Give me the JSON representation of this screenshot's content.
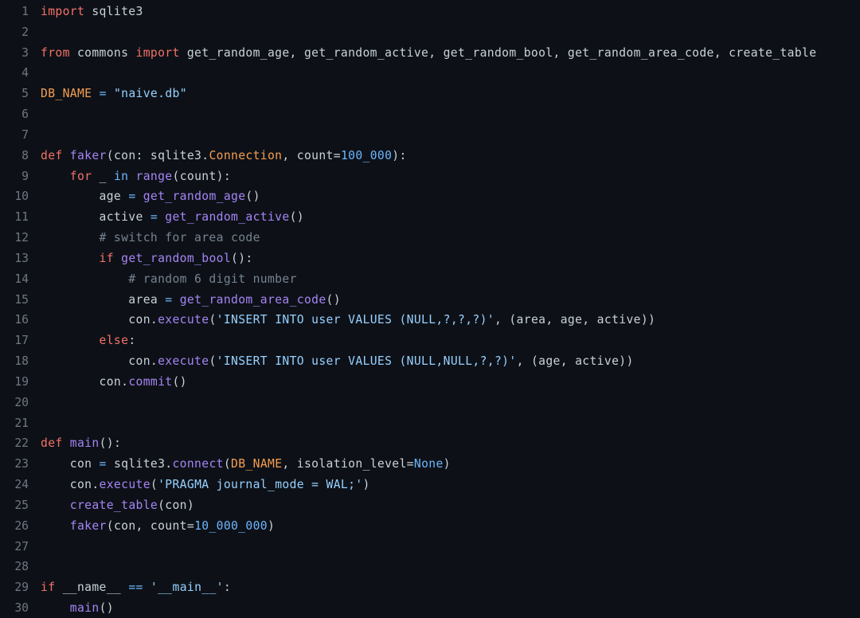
{
  "editor": {
    "language": "python",
    "theme": "github-dark-dimmed",
    "background_color": "#0d1117",
    "gutter_color": "#6e7681",
    "default_text_color": "#c9d1d9",
    "first_visible_line": 1,
    "last_visible_line": 30,
    "total_visible_lines": 30,
    "colors": {
      "keyword": "#f47067",
      "function": "#a684f5",
      "string": "#96d0ff",
      "number": "#6cb6ff",
      "constant": "#f69d50",
      "operator": "#6cb6ff",
      "comment": "#768390",
      "plain": "#c9d1d9"
    }
  },
  "lines": [
    {
      "number": "1",
      "tokens": [
        {
          "t": "import",
          "c": "t-kw"
        },
        {
          "t": " sqlite3",
          "c": "t-pln"
        }
      ]
    },
    {
      "number": "2",
      "tokens": []
    },
    {
      "number": "3",
      "tokens": [
        {
          "t": "from",
          "c": "t-kw"
        },
        {
          "t": " commons ",
          "c": "t-pln"
        },
        {
          "t": "import",
          "c": "t-kw"
        },
        {
          "t": " get_random_age, get_random_active, get_random_bool, get_random_area_code, create_table",
          "c": "t-pln"
        }
      ]
    },
    {
      "number": "4",
      "tokens": []
    },
    {
      "number": "5",
      "tokens": [
        {
          "t": "DB_NAME",
          "c": "t-cnst"
        },
        {
          "t": " ",
          "c": "t-pln"
        },
        {
          "t": "=",
          "c": "t-op"
        },
        {
          "t": " ",
          "c": "t-pln"
        },
        {
          "t": "\"naive.db\"",
          "c": "t-str"
        }
      ]
    },
    {
      "number": "6",
      "tokens": []
    },
    {
      "number": "7",
      "tokens": []
    },
    {
      "number": "8",
      "tokens": [
        {
          "t": "def",
          "c": "t-kw"
        },
        {
          "t": " ",
          "c": "t-pln"
        },
        {
          "t": "faker",
          "c": "t-fn"
        },
        {
          "t": "(con: sqlite3.",
          "c": "t-pln"
        },
        {
          "t": "Connection",
          "c": "t-cnst"
        },
        {
          "t": ", count=",
          "c": "t-pln"
        },
        {
          "t": "100_000",
          "c": "t-num"
        },
        {
          "t": "):",
          "c": "t-pln"
        }
      ]
    },
    {
      "number": "9",
      "tokens": [
        {
          "t": "    ",
          "c": "t-pln"
        },
        {
          "t": "for",
          "c": "t-kw"
        },
        {
          "t": " _ ",
          "c": "t-pln"
        },
        {
          "t": "in",
          "c": "t-op"
        },
        {
          "t": " ",
          "c": "t-pln"
        },
        {
          "t": "range",
          "c": "t-fn"
        },
        {
          "t": "(count):",
          "c": "t-pln"
        }
      ]
    },
    {
      "number": "10",
      "tokens": [
        {
          "t": "        age ",
          "c": "t-pln"
        },
        {
          "t": "=",
          "c": "t-op"
        },
        {
          "t": " ",
          "c": "t-pln"
        },
        {
          "t": "get_random_age",
          "c": "t-fn"
        },
        {
          "t": "()",
          "c": "t-pln"
        }
      ]
    },
    {
      "number": "11",
      "tokens": [
        {
          "t": "        active ",
          "c": "t-pln"
        },
        {
          "t": "=",
          "c": "t-op"
        },
        {
          "t": " ",
          "c": "t-pln"
        },
        {
          "t": "get_random_active",
          "c": "t-fn"
        },
        {
          "t": "()",
          "c": "t-pln"
        }
      ]
    },
    {
      "number": "12",
      "tokens": [
        {
          "t": "        ",
          "c": "t-pln"
        },
        {
          "t": "# switch for area code",
          "c": "t-cmt"
        }
      ]
    },
    {
      "number": "13",
      "tokens": [
        {
          "t": "        ",
          "c": "t-pln"
        },
        {
          "t": "if",
          "c": "t-kw"
        },
        {
          "t": " ",
          "c": "t-pln"
        },
        {
          "t": "get_random_bool",
          "c": "t-fn"
        },
        {
          "t": "():",
          "c": "t-pln"
        }
      ]
    },
    {
      "number": "14",
      "tokens": [
        {
          "t": "            ",
          "c": "t-pln"
        },
        {
          "t": "# random 6 digit number",
          "c": "t-cmt"
        }
      ]
    },
    {
      "number": "15",
      "tokens": [
        {
          "t": "            area ",
          "c": "t-pln"
        },
        {
          "t": "=",
          "c": "t-op"
        },
        {
          "t": " ",
          "c": "t-pln"
        },
        {
          "t": "get_random_area_code",
          "c": "t-fn"
        },
        {
          "t": "()",
          "c": "t-pln"
        }
      ]
    },
    {
      "number": "16",
      "tokens": [
        {
          "t": "            con.",
          "c": "t-pln"
        },
        {
          "t": "execute",
          "c": "t-fn"
        },
        {
          "t": "(",
          "c": "t-pln"
        },
        {
          "t": "'INSERT INTO user VALUES (NULL,?,?,?)'",
          "c": "t-str"
        },
        {
          "t": ", (area, age, active))",
          "c": "t-pln"
        }
      ]
    },
    {
      "number": "17",
      "tokens": [
        {
          "t": "        ",
          "c": "t-pln"
        },
        {
          "t": "else",
          "c": "t-kw"
        },
        {
          "t": ":",
          "c": "t-pln"
        }
      ]
    },
    {
      "number": "18",
      "tokens": [
        {
          "t": "            con.",
          "c": "t-pln"
        },
        {
          "t": "execute",
          "c": "t-fn"
        },
        {
          "t": "(",
          "c": "t-pln"
        },
        {
          "t": "'INSERT INTO user VALUES (NULL,NULL,?,?)'",
          "c": "t-str"
        },
        {
          "t": ", (age, active))",
          "c": "t-pln"
        }
      ]
    },
    {
      "number": "19",
      "tokens": [
        {
          "t": "        con.",
          "c": "t-pln"
        },
        {
          "t": "commit",
          "c": "t-fn"
        },
        {
          "t": "()",
          "c": "t-pln"
        }
      ]
    },
    {
      "number": "20",
      "tokens": []
    },
    {
      "number": "21",
      "tokens": []
    },
    {
      "number": "22",
      "tokens": [
        {
          "t": "def",
          "c": "t-kw"
        },
        {
          "t": " ",
          "c": "t-pln"
        },
        {
          "t": "main",
          "c": "t-fn"
        },
        {
          "t": "():",
          "c": "t-pln"
        }
      ]
    },
    {
      "number": "23",
      "tokens": [
        {
          "t": "    con ",
          "c": "t-pln"
        },
        {
          "t": "=",
          "c": "t-op"
        },
        {
          "t": " sqlite3.",
          "c": "t-pln"
        },
        {
          "t": "connect",
          "c": "t-fn"
        },
        {
          "t": "(",
          "c": "t-pln"
        },
        {
          "t": "DB_NAME",
          "c": "t-cnst"
        },
        {
          "t": ", isolation_level=",
          "c": "t-pln"
        },
        {
          "t": "None",
          "c": "t-num"
        },
        {
          "t": ")",
          "c": "t-pln"
        }
      ]
    },
    {
      "number": "24",
      "tokens": [
        {
          "t": "    con.",
          "c": "t-pln"
        },
        {
          "t": "execute",
          "c": "t-fn"
        },
        {
          "t": "(",
          "c": "t-pln"
        },
        {
          "t": "'PRAGMA journal_mode = WAL;'",
          "c": "t-str"
        },
        {
          "t": ")",
          "c": "t-pln"
        }
      ]
    },
    {
      "number": "25",
      "tokens": [
        {
          "t": "    ",
          "c": "t-pln"
        },
        {
          "t": "create_table",
          "c": "t-fn"
        },
        {
          "t": "(con)",
          "c": "t-pln"
        }
      ]
    },
    {
      "number": "26",
      "tokens": [
        {
          "t": "    ",
          "c": "t-pln"
        },
        {
          "t": "faker",
          "c": "t-fn"
        },
        {
          "t": "(con, count=",
          "c": "t-pln"
        },
        {
          "t": "10_000_000",
          "c": "t-num"
        },
        {
          "t": ")",
          "c": "t-pln"
        }
      ]
    },
    {
      "number": "27",
      "tokens": []
    },
    {
      "number": "28",
      "tokens": []
    },
    {
      "number": "29",
      "tokens": [
        {
          "t": "if",
          "c": "t-kw"
        },
        {
          "t": " __name__ ",
          "c": "t-pln"
        },
        {
          "t": "==",
          "c": "t-op"
        },
        {
          "t": " ",
          "c": "t-pln"
        },
        {
          "t": "'__main__'",
          "c": "t-str"
        },
        {
          "t": ":",
          "c": "t-pln"
        }
      ]
    },
    {
      "number": "30",
      "tokens": [
        {
          "t": "    ",
          "c": "t-pln"
        },
        {
          "t": "main",
          "c": "t-fn"
        },
        {
          "t": "()",
          "c": "t-pln"
        }
      ]
    }
  ]
}
